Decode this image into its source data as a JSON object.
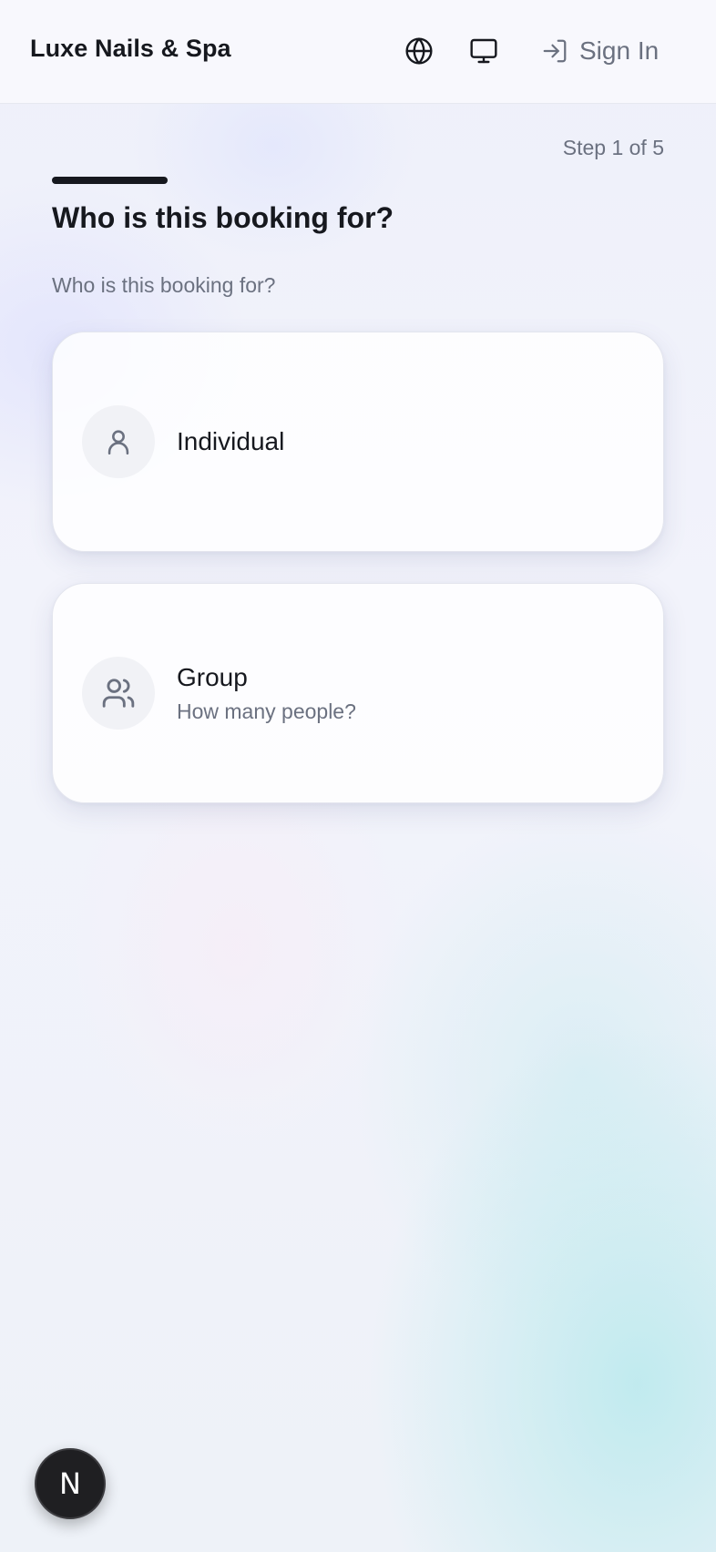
{
  "app": {
    "name": "Luxe Nails & Spa"
  },
  "header": {
    "icons": [
      "globe-icon",
      "monitor-icon"
    ],
    "sign_in_label": "Sign In",
    "sign_in_icon": "log-in-icon"
  },
  "step": {
    "label": "Step 1 of 5",
    "current": 1,
    "total": 5,
    "progress_fraction": 0.2
  },
  "page": {
    "title": "Who is this booking for?",
    "subtitle": "Who is this booking for?"
  },
  "options": [
    {
      "label": "Individual",
      "icon": "user-icon"
    },
    {
      "label": "Group",
      "sublabel": "How many people?",
      "icon": "users-icon"
    }
  ],
  "fab": {
    "letter": "N"
  },
  "colors": {
    "text_primary": "#16181e",
    "text_muted": "#6b7180",
    "progress": "#16181e",
    "fab_background": "#1f1f22"
  }
}
